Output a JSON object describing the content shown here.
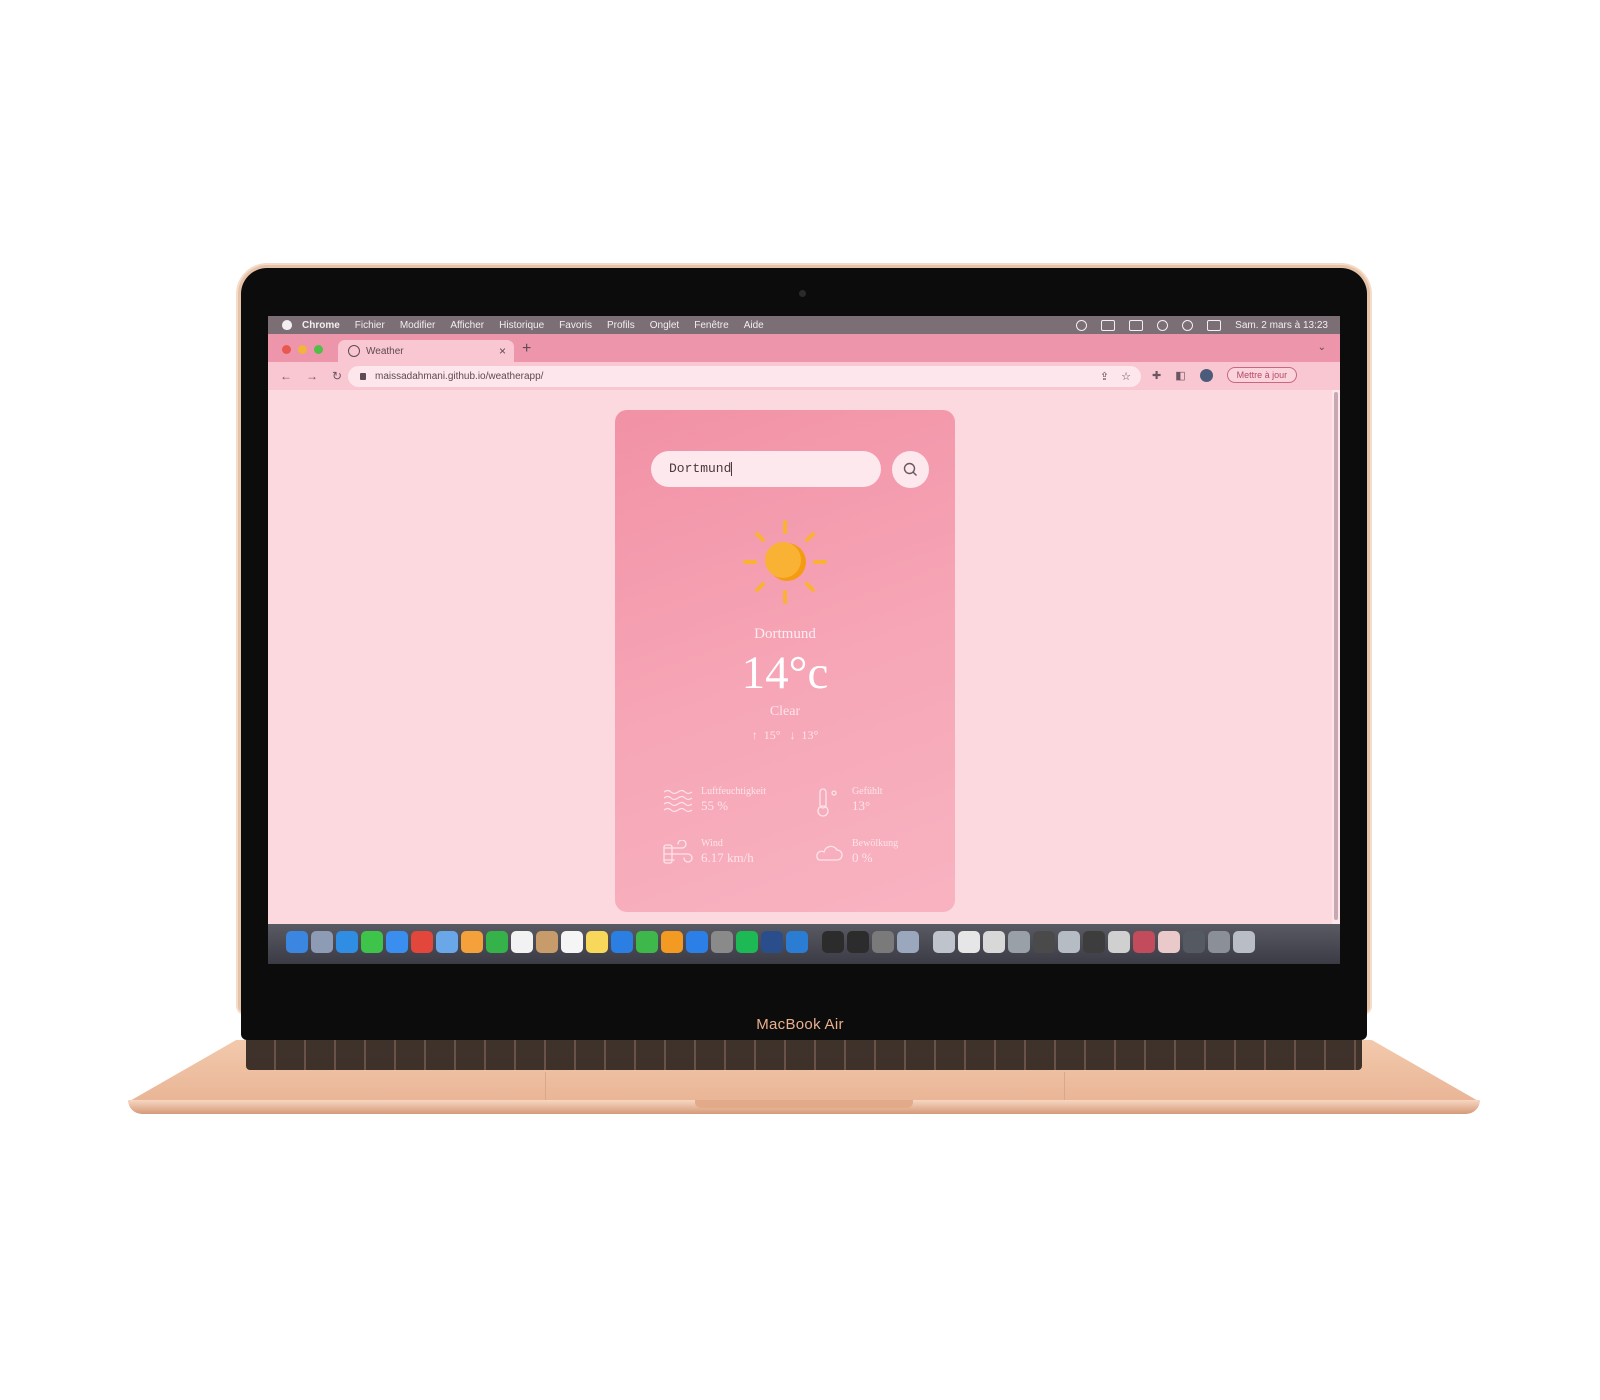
{
  "device": {
    "brand_label": "MacBook Air"
  },
  "menubar": {
    "app": "Chrome",
    "items": [
      "Fichier",
      "Modifier",
      "Afficher",
      "Historique",
      "Favoris",
      "Profils",
      "Onglet",
      "Fenêtre",
      "Aide"
    ],
    "datetime": "Sam. 2 mars à 13:23"
  },
  "browser": {
    "tab_title": "Weather",
    "url": "maissadahmani.github.io/weatherapp/",
    "update_button": "Mettre à jour"
  },
  "weather": {
    "search_value": "Dortmund",
    "city": "Dortmund",
    "temperature": "14°c",
    "condition": "Clear",
    "max": "15°",
    "min": "13°",
    "stats": {
      "humidity": {
        "label": "Luftfeuchtigkeit",
        "value": "55 %"
      },
      "feels_like": {
        "label": "Gefühlt",
        "value": "13°"
      },
      "wind": {
        "label": "Wind",
        "value": "6.17 km/h"
      },
      "clouds": {
        "label": "Bewölkung",
        "value": "0 %"
      }
    }
  },
  "colors": {
    "card_top": "#f291a6",
    "card_bottom": "#f8b3c1",
    "page_bg": "#fcd8df",
    "sun": "#f9b233"
  }
}
